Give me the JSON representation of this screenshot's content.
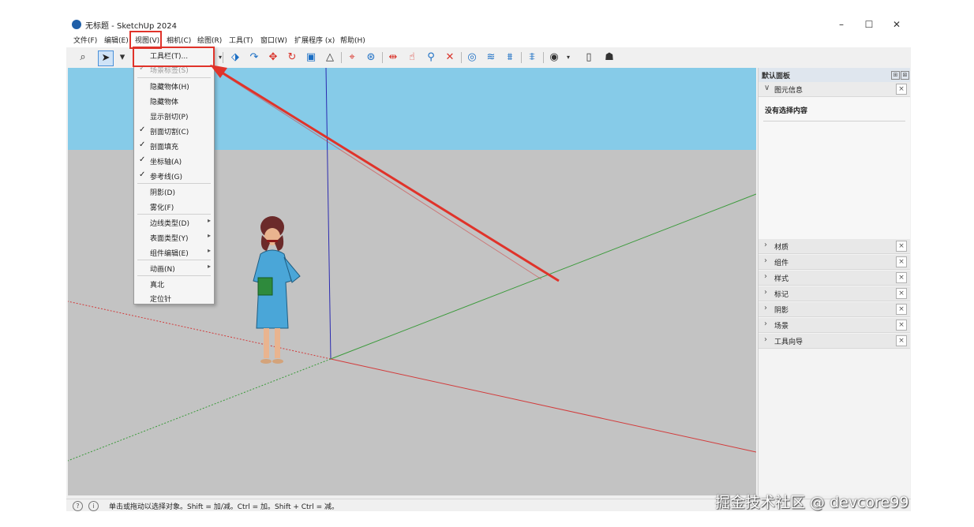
{
  "window": {
    "title": "无标题 - SketchUp 2024",
    "minimize": "–",
    "maximize": "☐",
    "close": "✕"
  },
  "menubar": [
    {
      "label": "文件(F)"
    },
    {
      "label": "编辑(E)"
    },
    {
      "label": "视图(V)"
    },
    {
      "label": "相机(C)"
    },
    {
      "label": "绘图(R)"
    },
    {
      "label": "工具(T)"
    },
    {
      "label": "窗口(W)"
    },
    {
      "label": "扩展程序 (x)"
    },
    {
      "label": "帮助(H)"
    }
  ],
  "toolbar": {
    "icons": [
      "zoom-icon",
      "select-icon",
      "paint-icon",
      "push-pull-icon",
      "follow-me-icon",
      "move-icon",
      "rotate-icon",
      "scale-icon",
      "offset-icon",
      "section-plane-icon",
      "orbit-icon",
      "pan-icon",
      "zoom-tool-icon",
      "zoom-extents-icon",
      "warehouse-icon",
      "extension-warehouse-icon",
      "layout-icon",
      "styles-icon",
      "user-icon",
      "new-file-icon",
      "account-icon"
    ]
  },
  "view_menu": {
    "items": [
      {
        "label": "工具栏(T)...",
        "checked": false,
        "submenu": false,
        "disabled": false
      },
      {
        "label": "场景标签(S)",
        "checked": true,
        "submenu": false,
        "disabled": true
      },
      {
        "label": "隐藏物体(H)",
        "checked": false,
        "submenu": false,
        "disabled": false
      },
      {
        "label": "隐藏物体",
        "checked": false,
        "submenu": false,
        "disabled": false
      },
      {
        "label": "显示剖切(P)",
        "checked": false,
        "submenu": false,
        "disabled": false
      },
      {
        "label": "剖面切割(C)",
        "checked": true,
        "submenu": false,
        "disabled": false
      },
      {
        "label": "剖面填充",
        "checked": true,
        "submenu": false,
        "disabled": false
      },
      {
        "label": "坐标轴(A)",
        "checked": true,
        "submenu": false,
        "disabled": false
      },
      {
        "label": "参考线(G)",
        "checked": true,
        "submenu": false,
        "disabled": false
      },
      {
        "label": "阴影(D)",
        "checked": false,
        "submenu": false,
        "disabled": false
      },
      {
        "label": "雾化(F)",
        "checked": false,
        "submenu": false,
        "disabled": false
      },
      {
        "label": "边线类型(D)",
        "checked": false,
        "submenu": true,
        "disabled": false
      },
      {
        "label": "表面类型(Y)",
        "checked": false,
        "submenu": true,
        "disabled": false
      },
      {
        "label": "组件编辑(E)",
        "checked": false,
        "submenu": true,
        "disabled": false
      },
      {
        "label": "动画(N)",
        "checked": false,
        "submenu": true,
        "disabled": false
      },
      {
        "label": "真北",
        "checked": false,
        "submenu": false,
        "disabled": false
      },
      {
        "label": "定位针",
        "checked": false,
        "submenu": false,
        "disabled": false
      }
    ]
  },
  "panel": {
    "title": "默认面板",
    "entity_info": {
      "label": "图元信息",
      "content": "没有选择内容"
    },
    "trays": [
      {
        "label": "材质"
      },
      {
        "label": "组件"
      },
      {
        "label": "样式"
      },
      {
        "label": "标记"
      },
      {
        "label": "阴影"
      },
      {
        "label": "场景"
      },
      {
        "label": "工具向导"
      }
    ]
  },
  "status": {
    "text": "单击或拖动以选择对象。Shift = 加/减。Ctrl = 加。Shift + Ctrl = 减。"
  },
  "watermark": "掘金技术社区 @ devcore99",
  "colors": {
    "sky": "#86cbe8",
    "ground": "#c3c3c3",
    "highlight": "#e0332a",
    "axis_red": "#d23b3b",
    "axis_green": "#3a9a3a",
    "axis_blue": "#2a2ab0"
  }
}
